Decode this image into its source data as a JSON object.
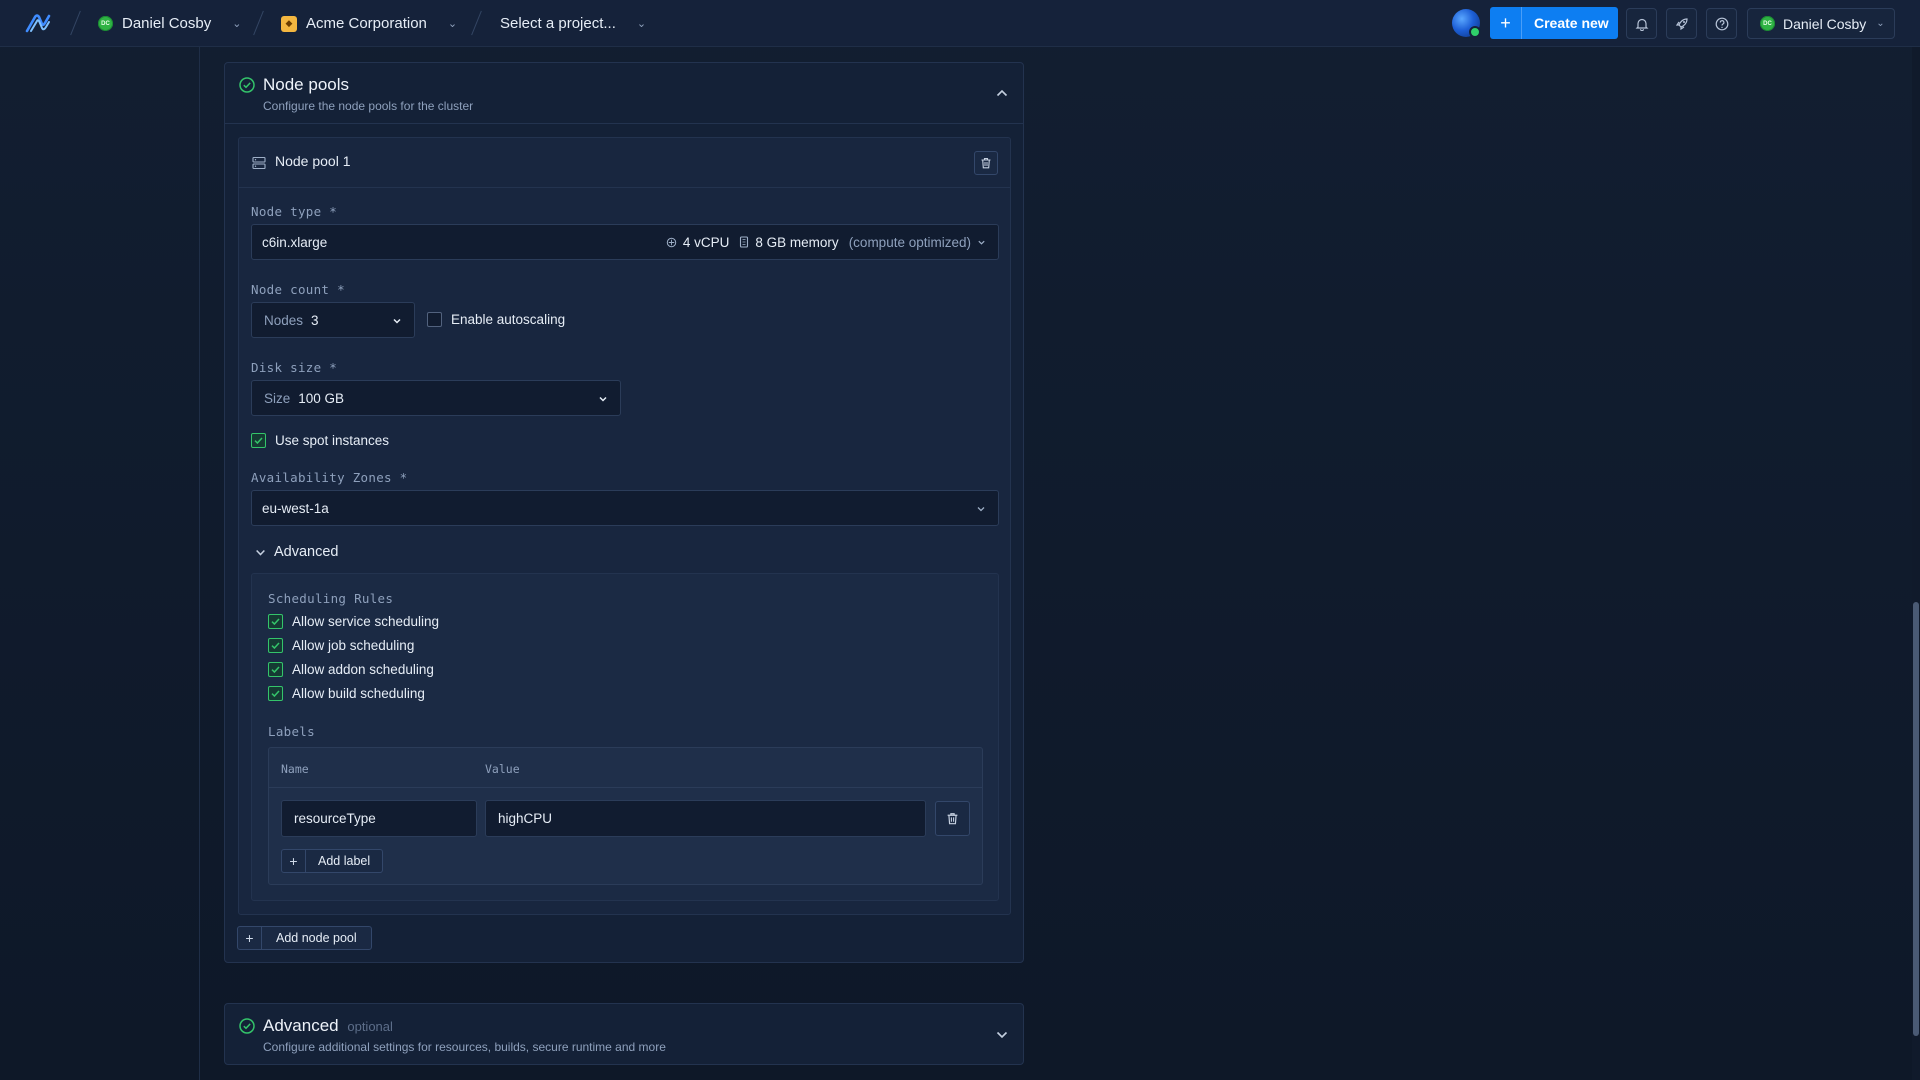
{
  "header": {
    "user_crumb": {
      "initials": "DC",
      "name": "Daniel Cosby"
    },
    "org_crumb": {
      "name": "Acme Corporation"
    },
    "project_crumb": {
      "placeholder": "Select a project..."
    },
    "create_new_label": "Create new",
    "user_menu": {
      "initials": "DC",
      "name": "Daniel Cosby"
    }
  },
  "node_pools": {
    "title": "Node pools",
    "subtitle": "Configure the node pools for the cluster",
    "pool": {
      "title": "Node pool 1",
      "node_type": {
        "label": "Node type *",
        "value": "c6in.xlarge",
        "cpu": "4 vCPU",
        "memory": "8 GB memory",
        "category": "(compute optimized)"
      },
      "node_count": {
        "label": "Node count *",
        "prefix": "Nodes",
        "value": "3",
        "autoscaling_label": "Enable autoscaling",
        "autoscaling_checked": false
      },
      "disk_size": {
        "label": "Disk size *",
        "prefix": "Size",
        "value": "100 GB"
      },
      "spot_instances": {
        "label": "Use spot instances",
        "checked": true
      },
      "availability_zones": {
        "label": "Availability Zones *",
        "value": "eu-west-1a"
      },
      "advanced": {
        "toggle_label": "Advanced",
        "scheduling_title": "Scheduling Rules",
        "rules": [
          {
            "label": "Allow service scheduling",
            "checked": true
          },
          {
            "label": "Allow job scheduling",
            "checked": true
          },
          {
            "label": "Allow addon scheduling",
            "checked": true
          },
          {
            "label": "Allow build scheduling",
            "checked": true
          }
        ],
        "labels_title": "Labels",
        "labels_table": {
          "columns": [
            "Name",
            "Value"
          ],
          "rows": [
            {
              "name": "resourceType",
              "value": "highCPU"
            }
          ],
          "add_label": "Add label"
        }
      }
    },
    "add_pool_label": "Add node pool"
  },
  "advanced_section": {
    "title": "Advanced",
    "badge": "optional",
    "subtitle": "Configure additional settings for resources, builds, secure runtime and more"
  },
  "colors": {
    "accent": "#0d7ef2",
    "success": "#34c46a",
    "background": "#0f1a2b"
  }
}
